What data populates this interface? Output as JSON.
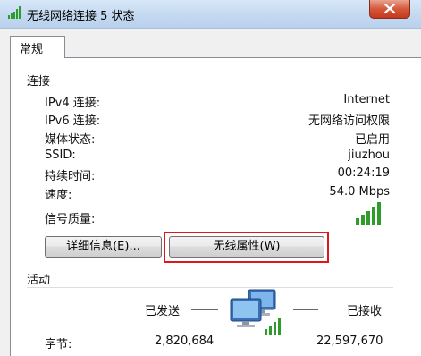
{
  "window": {
    "title": "无线网络连接 5 状态"
  },
  "tabs": [
    {
      "label": "常规"
    }
  ],
  "connection": {
    "heading": "连接",
    "rows": [
      {
        "label": "IPv4 连接:",
        "value": "Internet"
      },
      {
        "label": "IPv6 连接:",
        "value": "无网络访问权限"
      },
      {
        "label": "媒体状态:",
        "value": "已启用"
      },
      {
        "label": "SSID:",
        "value": "jiuzhou"
      },
      {
        "label": "持续时间:",
        "value": "00:24:19"
      },
      {
        "label": "速度:",
        "value": "54.0 Mbps"
      }
    ],
    "signal_label": "信号质量:"
  },
  "buttons": {
    "details": "详细信息(E)...",
    "wireless_properties": "无线属性(W)"
  },
  "activity": {
    "heading": "活动",
    "sent_label": "已发送",
    "received_label": "已接收",
    "bytes_label": "字节:",
    "bytes_sent": "2,820,684",
    "bytes_received": "22,597,670"
  },
  "colors": {
    "highlight": "#e0161c",
    "signal": "#2e9c2a",
    "titlebar": "#c4d9f1"
  },
  "icons": {
    "title": "wifi-signal-icon",
    "signal": "signal-strength-icon",
    "network": "network-computers-icon"
  }
}
